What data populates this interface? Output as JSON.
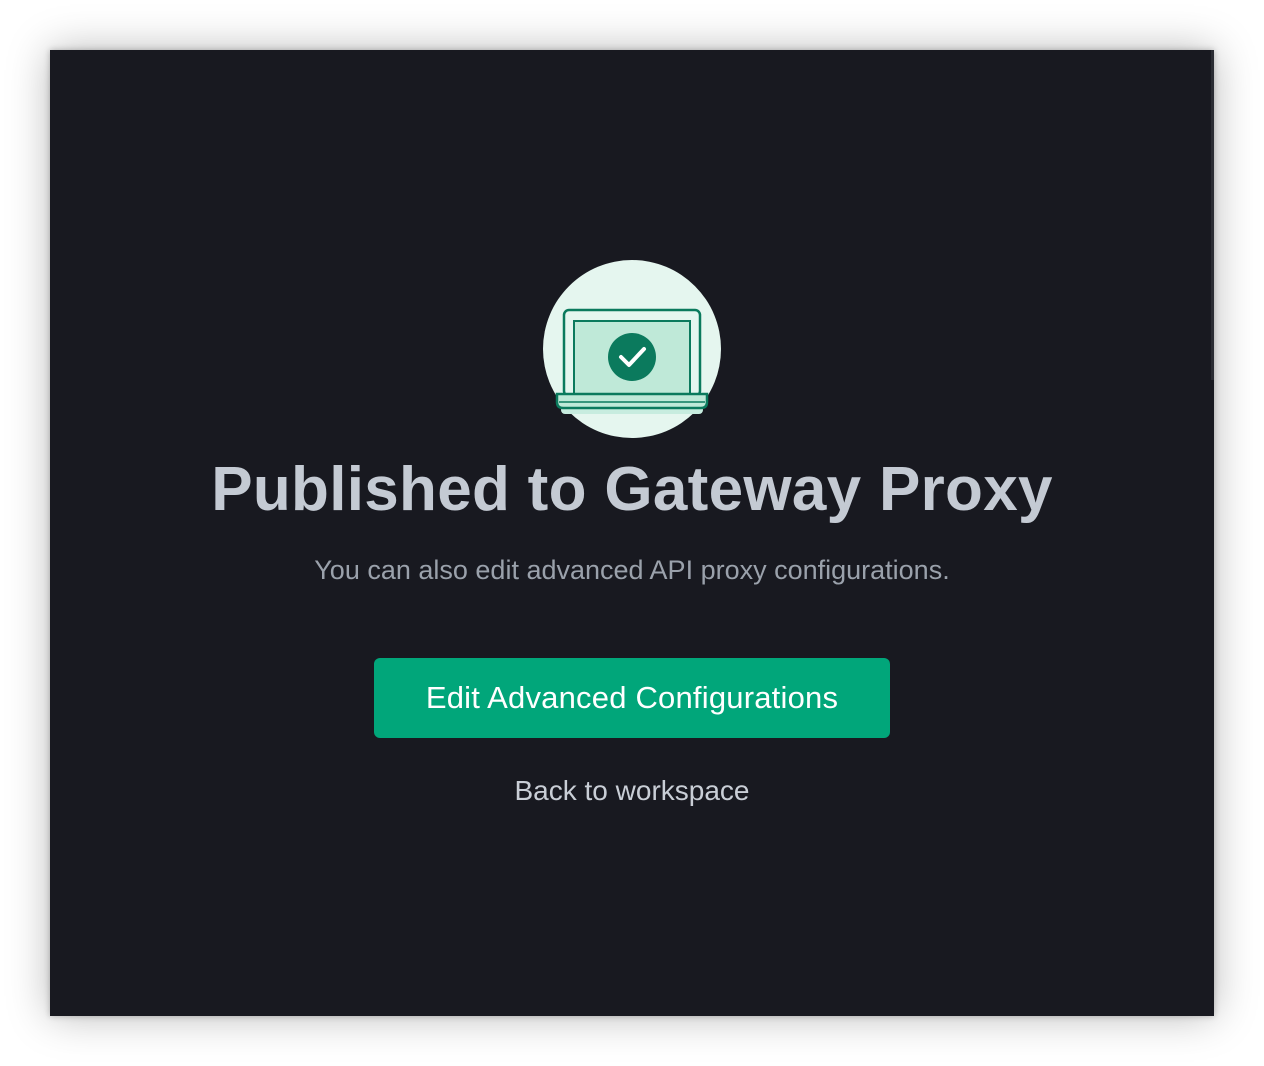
{
  "dialog": {
    "title": "Published to Gateway Proxy",
    "subtitle": "You can also edit advanced API proxy configurations.",
    "primary_button_label": "Edit Advanced Configurations",
    "secondary_link_label": "Back to workspace"
  },
  "icons": {
    "illustration": "laptop-success-icon",
    "check": "checkmark-icon"
  },
  "colors": {
    "background": "#181920",
    "accent": "#01a67a",
    "illustration_circle": "#e5f6ef",
    "illustration_dark": "#0b7a5d"
  }
}
